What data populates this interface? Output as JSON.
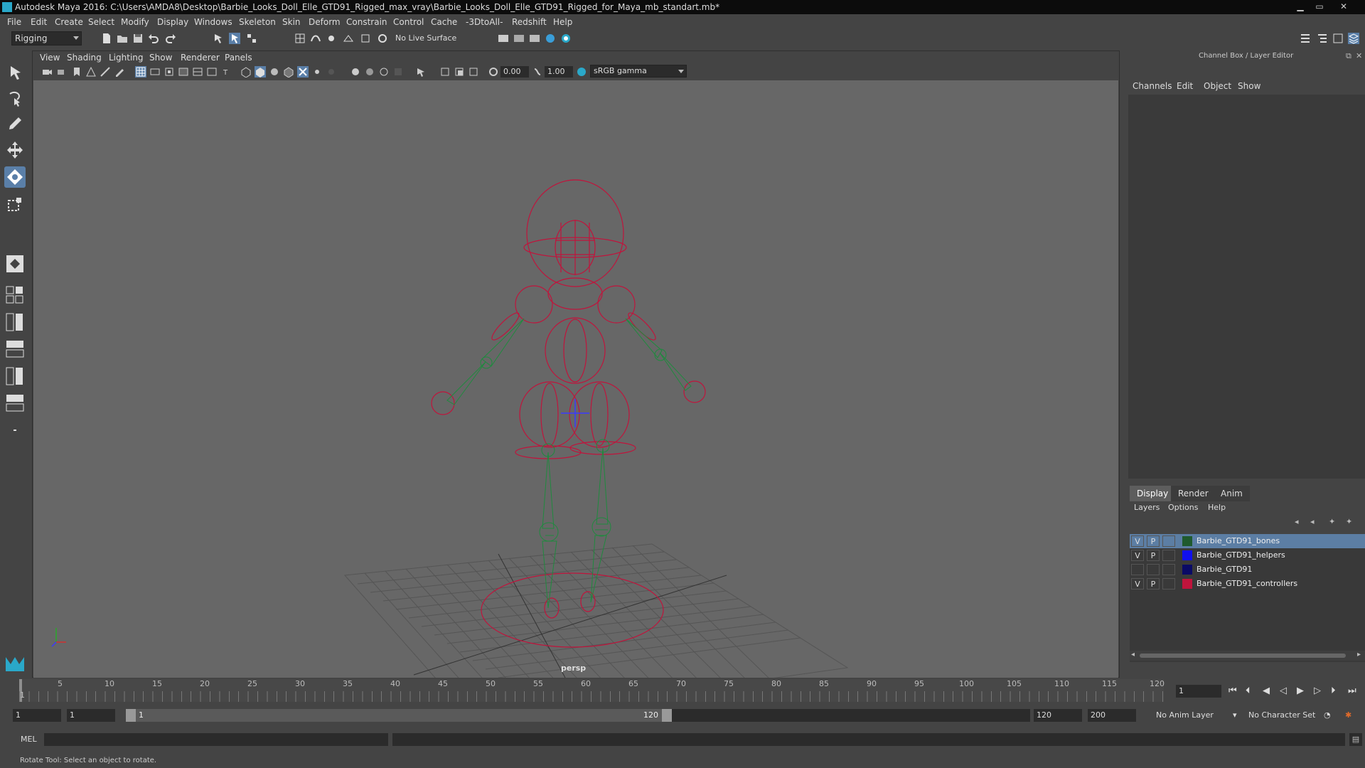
{
  "title": "Autodesk Maya 2016: C:\\Users\\AMDA8\\Desktop\\Barbie_Looks_Doll_Elle_GTD91_Rigged_max_vray\\Barbie_Looks_Doll_Elle_GTD91_Rigged_for_Maya_mb_standart.mb*",
  "menu": [
    "File",
    "Edit",
    "Create",
    "Select",
    "Modify",
    "Display",
    "Windows",
    "Skeleton",
    "Skin",
    "Deform",
    "Constrain",
    "Control",
    "Cache",
    "-3DtoAll-",
    "Redshift",
    "Help"
  ],
  "shelf": {
    "mode": "Rigging",
    "live_surface": "No Live Surface"
  },
  "panel_menu": [
    "View",
    "Shading",
    "Lighting",
    "Show",
    "Renderer",
    "Panels"
  ],
  "panel_toolbar": {
    "exposure": "0.00",
    "gamma": "1.00",
    "color_space": "sRGB gamma"
  },
  "viewport": {
    "camera_label": "persp"
  },
  "channel_box": {
    "title": "Channel Box / Layer Editor",
    "menu": [
      "Channels",
      "Edit",
      "Object",
      "Show"
    ]
  },
  "layer_editor": {
    "tabs": [
      "Display",
      "Render",
      "Anim"
    ],
    "menu": [
      "Layers",
      "Options",
      "Help"
    ],
    "layers": [
      {
        "v": "V",
        "p": "P",
        "name": "Barbie_GTD91_bones",
        "color": "#1f5a2e",
        "selected": true
      },
      {
        "v": "V",
        "p": "P",
        "name": "Barbie_GTD91_helpers",
        "color": "#1010ee",
        "selected": false
      },
      {
        "v": "",
        "p": "",
        "name": "Barbie_GTD91",
        "color": "#0a0a66",
        "selected": false
      },
      {
        "v": "V",
        "p": "P",
        "name": "Barbie_GTD91_controllers",
        "color": "#c0143c",
        "selected": false
      }
    ]
  },
  "timeline": {
    "ticks": [
      "1",
      "5",
      "10",
      "15",
      "20",
      "25",
      "30",
      "35",
      "40",
      "45",
      "50",
      "55",
      "60",
      "65",
      "70",
      "75",
      "80",
      "85",
      "90",
      "95",
      "100",
      "105",
      "110",
      "115",
      "120"
    ],
    "current_frame": "1"
  },
  "range": {
    "start": "1",
    "playback_start": "1",
    "slider_start": "1",
    "slider_end": "120",
    "playback_end": "120",
    "end": "200",
    "anim_layer": "No Anim Layer",
    "char_set": "No Character Set"
  },
  "cmd": {
    "label": "MEL"
  },
  "help": {
    "text": "Rotate Tool: Select an object to rotate."
  }
}
